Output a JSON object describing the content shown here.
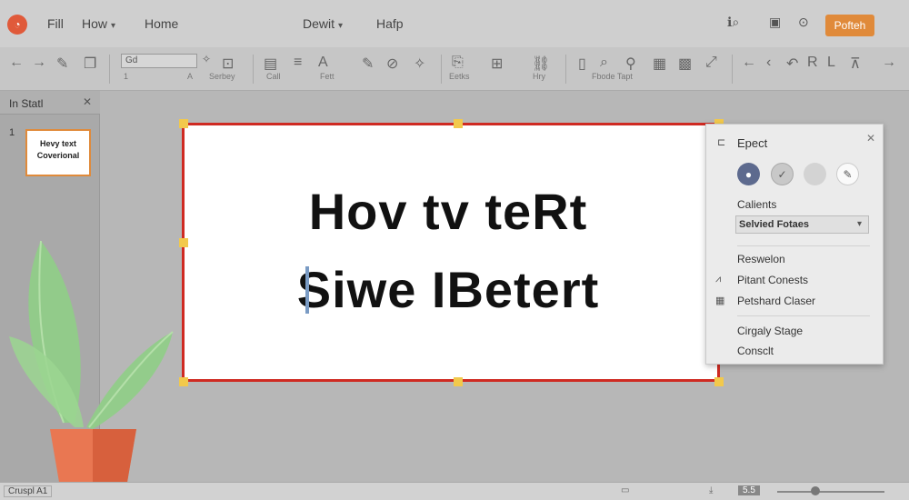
{
  "menubar": {
    "items": [
      {
        "label": "Fill",
        "has_chevron": false
      },
      {
        "label": "How",
        "has_chevron": true
      },
      {
        "label": "Home",
        "has_chevron": false
      },
      {
        "label": "Dewit",
        "has_chevron": true
      },
      {
        "label": "Hafp",
        "has_chevron": false
      }
    ],
    "publish_label": "Pofteh",
    "accent_color": "#e08a3a"
  },
  "ribbon": {
    "font_input_value": "Gd",
    "labels": {
      "size": "1",
      "size_a": "A",
      "section": "Serbey",
      "cell": "Call",
      "font": "Fett",
      "paste": "Eetks",
      "style": "Hry",
      "date": "Fbode Tapt"
    }
  },
  "leftpane": {
    "title": "In Statl",
    "slide_number": "1",
    "thumb_lines": [
      "Hevy text",
      "Coverional"
    ]
  },
  "slide": {
    "line1": "Hov tv teRt",
    "line2": "Siwe IBetert"
  },
  "panel": {
    "title": "Epect",
    "section_label": "Calients",
    "select_value": "Selvied Fotaes",
    "items": [
      "Reswelon",
      "Pitant Conests",
      "Petshard Claser",
      "Cirgaly Stage",
      "Consclt"
    ]
  },
  "statusbar": {
    "left_label": "Cruspl A1",
    "zoom": "5.5"
  }
}
